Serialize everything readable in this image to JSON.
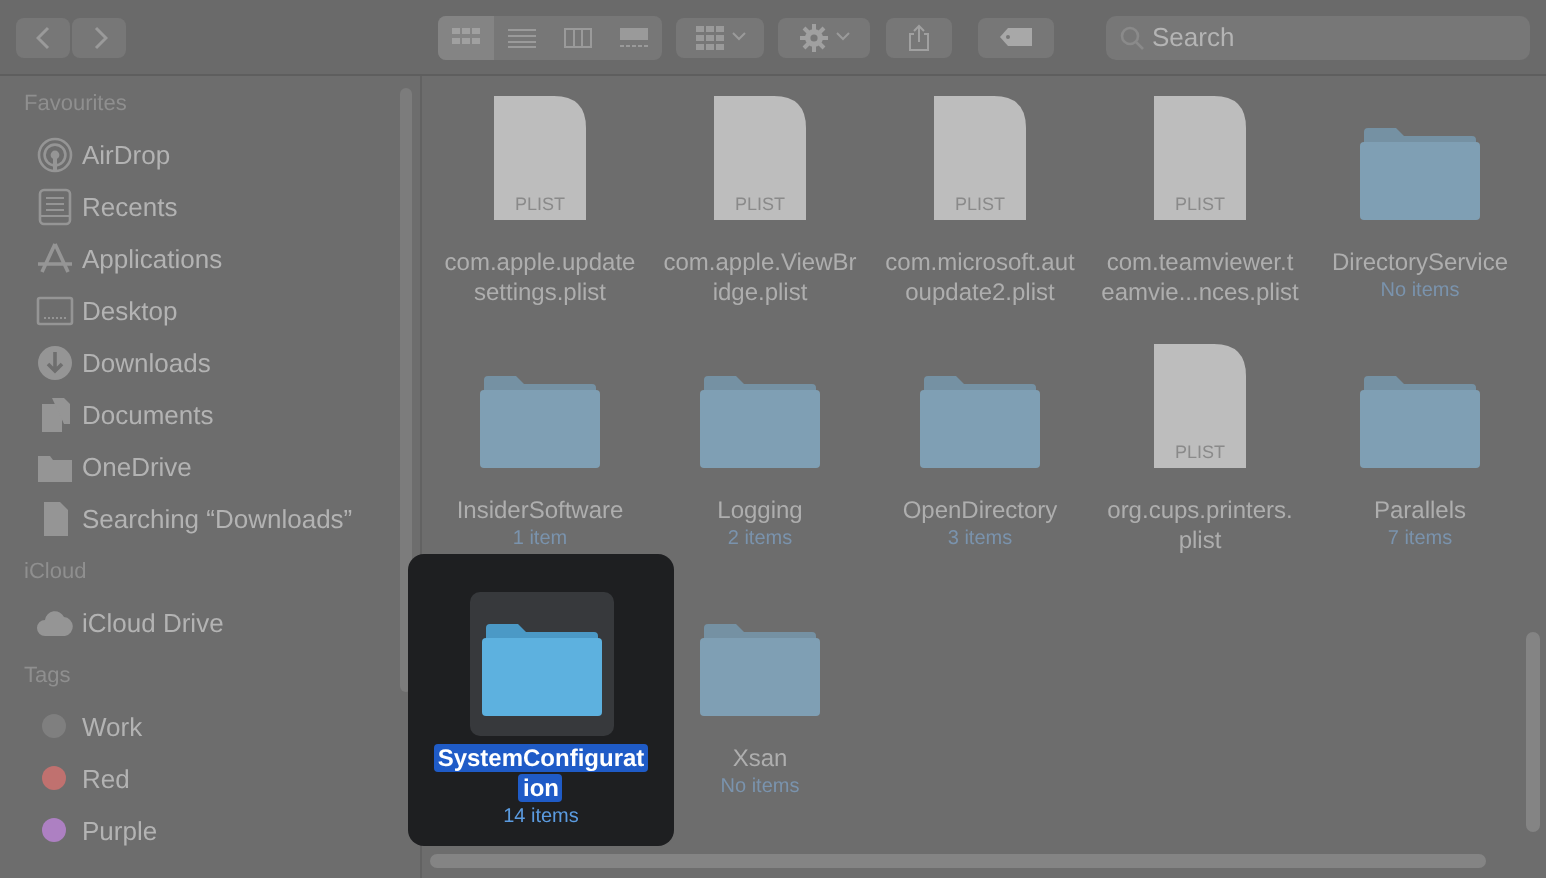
{
  "toolbar": {
    "view_modes": [
      {
        "kind": "icons",
        "selected": true
      },
      {
        "kind": "list",
        "selected": false
      },
      {
        "kind": "columns",
        "selected": false
      },
      {
        "kind": "gallery",
        "selected": false
      }
    ],
    "search": {
      "placeholder": "Search"
    }
  },
  "sidebar": {
    "sections": [
      {
        "title": "Favourites",
        "items": [
          {
            "label": "AirDrop"
          },
          {
            "label": "Recents"
          },
          {
            "label": "Applications"
          },
          {
            "label": "Desktop"
          },
          {
            "label": "Downloads"
          },
          {
            "label": "Documents"
          },
          {
            "label": "OneDrive"
          },
          {
            "label": "Searching “Downloads”"
          }
        ]
      },
      {
        "title": "iCloud",
        "items": [
          {
            "label": "iCloud Drive"
          }
        ]
      },
      {
        "title": "Tags",
        "items": [
          {
            "label": "Work",
            "color": "#7f7f7f"
          },
          {
            "label": "Red",
            "color": "#c0716f"
          },
          {
            "label": "Purple",
            "color": "#ad80c2"
          }
        ]
      }
    ]
  },
  "files": [
    {
      "kind": "plist",
      "badge": "PLIST",
      "name_lines": [
        "com.apple.update",
        "settings.plist"
      ],
      "selected": false
    },
    {
      "kind": "plist",
      "badge": "PLIST",
      "name_lines": [
        "com.apple.ViewBr",
        "idge.plist"
      ],
      "selected": false
    },
    {
      "kind": "plist",
      "badge": "PLIST",
      "name_lines": [
        "com.microsoft.aut",
        "oupdate2.plist"
      ],
      "selected": false
    },
    {
      "kind": "plist",
      "badge": "PLIST",
      "name_lines": [
        "com.teamviewer.t",
        "eamvie...nces.plist"
      ],
      "selected": false
    },
    {
      "kind": "folder",
      "name_lines": [
        "DirectoryService"
      ],
      "count": "No items",
      "selected": false
    },
    {
      "kind": "folder",
      "name_lines": [
        "InsiderSoftware"
      ],
      "count": "1 item",
      "selected": false
    },
    {
      "kind": "folder",
      "name_lines": [
        "Logging"
      ],
      "count": "2 items",
      "selected": false
    },
    {
      "kind": "folder",
      "name_lines": [
        "OpenDirectory"
      ],
      "count": "3 items",
      "selected": false
    },
    {
      "kind": "plist",
      "badge": "PLIST",
      "name_lines": [
        "org.cups.printers.",
        "plist"
      ],
      "selected": false
    },
    {
      "kind": "folder",
      "name_lines": [
        "Parallels"
      ],
      "count": "7 items",
      "selected": false
    },
    {
      "kind": "folder",
      "name_lines": [
        "SystemConfigurat",
        "ion"
      ],
      "count": "14 items",
      "selected": true
    },
    {
      "kind": "folder",
      "name_lines": [
        "Xsan"
      ],
      "count": "No items",
      "selected": false
    }
  ]
}
